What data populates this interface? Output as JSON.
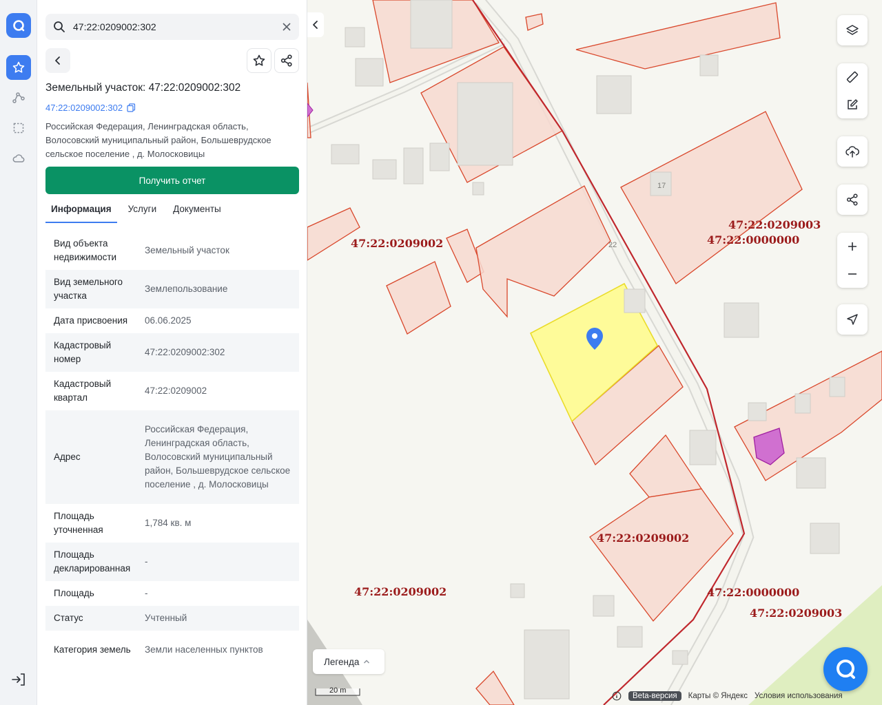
{
  "search": {
    "value": "47:22:0209002:302"
  },
  "object": {
    "title": "Земельный участок: 47:22:0209002:302",
    "cadastral_link": "47:22:0209002:302",
    "address": "Российская Федерация, Ленинградская область, Волосовский муниципальный район, Большеврудское сельское поселение , д. Молосковицы"
  },
  "report_button": "Получить отчет",
  "tabs": [
    "Информация",
    "Услуги",
    "Документы"
  ],
  "info_rows": [
    {
      "key": "Вид объекта недвижимости",
      "value": "Земельный участок"
    },
    {
      "key": "Вид земельного участка",
      "value": "Землепользование"
    },
    {
      "key": "Дата присвоения",
      "value": "06.06.2025"
    },
    {
      "key": "Кадастровый номер",
      "value": "47:22:0209002:302"
    },
    {
      "key": "Кадастровый квартал",
      "value": "47:22:0209002"
    },
    {
      "key": "Адрес",
      "value": "Российская Федерация, Ленинградская область, Волосовский муниципальный район, Большеврудское сельское поселение , д. Молосковицы"
    },
    {
      "key": "Площадь уточненная",
      "value": "1,784 кв. м"
    },
    {
      "key": "Площадь декларированная",
      "value": "-"
    },
    {
      "key": "Площадь",
      "value": "-"
    },
    {
      "key": "Статус",
      "value": "Учтенный"
    },
    {
      "key": "Категория земель",
      "value": "Земли населенных пунктов"
    }
  ],
  "map": {
    "quarter_labels": [
      "47:22:0209002",
      "47:22:0209003",
      "47:22:0000000",
      "47:22:0209002",
      "47:22:0209002",
      "47:22:0000000",
      "47:22:0209003"
    ],
    "house_numbers": [
      "17",
      "22"
    ],
    "legend": "Легенда",
    "scale": "20 m",
    "beta": "Beta-версия",
    "copyright": "Карты © Яндекс",
    "terms": "Условия использования"
  },
  "colors": {
    "accent": "#3d7cf0",
    "report_button": "#0a9264",
    "parcel_selected": "#fffb8a",
    "parcel_border": "#d9472b",
    "quarter_border": "#c0272d"
  }
}
